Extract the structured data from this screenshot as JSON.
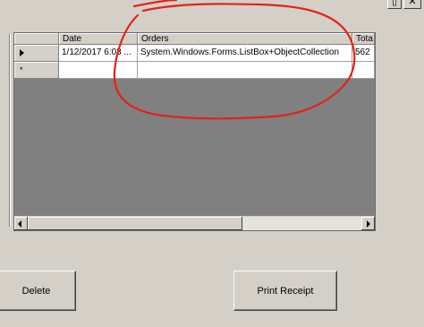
{
  "window": {
    "restore_glyph": "▯",
    "close_glyph": "✕"
  },
  "grid": {
    "columns": [
      "Date",
      "Orders",
      "Tota"
    ],
    "rows": [
      {
        "date": "1/12/2017 6:03 ...",
        "orders": "System.Windows.Forms.ListBox+ObjectCollection",
        "total": "562"
      }
    ],
    "new_row_marker": "*"
  },
  "buttons": {
    "delete": "Delete",
    "print_receipt": "Print Receipt"
  },
  "annotation": {
    "color": "#e0241b"
  }
}
